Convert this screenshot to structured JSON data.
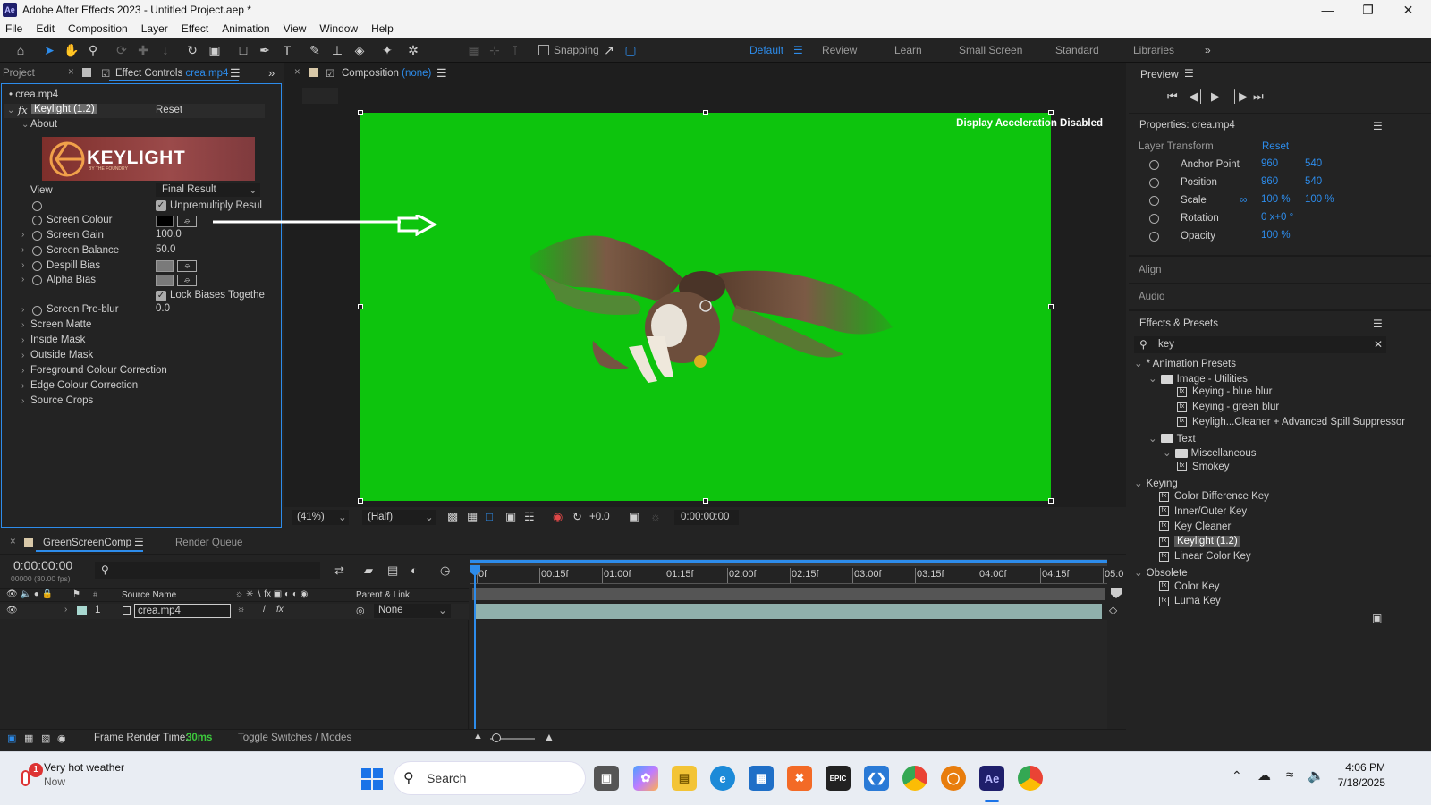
{
  "window": {
    "title": "Adobe After Effects 2023 - Untitled Project.aep *",
    "app_icon": "Ae"
  },
  "menu": [
    "File",
    "Edit",
    "Composition",
    "Layer",
    "Effect",
    "Animation",
    "View",
    "Window",
    "Help"
  ],
  "toolbar": {
    "snapping_label": "Snapping",
    "workspaces": [
      "Default",
      "Review",
      "Learn",
      "Small Screen",
      "Standard",
      "Libraries"
    ],
    "active_workspace": "Default"
  },
  "left_panel": {
    "tab_project": "Project",
    "tab_effect_controls": "Effect Controls",
    "tab_file": "crea.mp4",
    "layer_name": "• crea.mp4",
    "effect_name": "Keylight (1.2)",
    "reset": "Reset",
    "about": "About",
    "logo_text": "KEYLIGHT",
    "logo_sub": "BY THE FOUNDRY",
    "view_label": "View",
    "view_value": "Final Result",
    "unpremultiply": "Unpremultiply Resul",
    "screen_colour": "Screen Colour",
    "screen_gain": "Screen Gain",
    "screen_gain_val": "100.0",
    "screen_balance": "Screen Balance",
    "screen_balance_val": "50.0",
    "despill_bias": "Despill Bias",
    "alpha_bias": "Alpha Bias",
    "lock_biases": "Lock Biases Togethe",
    "screen_preblur": "Screen Pre-blur",
    "screen_preblur_val": "0.0",
    "groups": [
      "Screen Matte",
      "Inside Mask",
      "Outside Mask",
      "Foreground Colour Correction",
      "Edge Colour Correction",
      "Source Crops"
    ]
  },
  "composition": {
    "tab_label": "Composition",
    "tab_value": "(none)",
    "accel_msg": "Display Acceleration Disabled",
    "background_color": "#0dc40d",
    "zoom": "(41%)",
    "resolution": "(Half)",
    "exposure": "+0.0",
    "timecode": "0:00:00:00"
  },
  "right_panel": {
    "preview": "Preview",
    "properties_title": "Properties: crea.mp4",
    "layer_transform": "Layer Transform",
    "reset": "Reset",
    "props": [
      {
        "name": "Anchor Point",
        "v1": "960",
        "v2": "540"
      },
      {
        "name": "Position",
        "v1": "960",
        "v2": "540"
      },
      {
        "name": "Scale",
        "v1": "100 %",
        "v2": "100 %"
      },
      {
        "name": "Rotation",
        "v1": "0 x+0 °",
        "v2": ""
      },
      {
        "name": "Opacity",
        "v1": "100 %",
        "v2": ""
      }
    ],
    "align": "Align",
    "audio": "Audio",
    "effects_presets": "Effects & Presets",
    "search_value": "key",
    "tree": [
      {
        "label": "* Animation Presets",
        "indent": 0,
        "type": "caret"
      },
      {
        "label": "Image - Utilities",
        "indent": 1,
        "type": "folder"
      },
      {
        "label": "Keying - blue blur",
        "indent": 3,
        "type": "preset"
      },
      {
        "label": "Keying - green blur",
        "indent": 3,
        "type": "preset"
      },
      {
        "label": "Keyligh...Cleaner + Advanced Spill Suppressor",
        "indent": 3,
        "type": "preset"
      },
      {
        "label": "Text",
        "indent": 1,
        "type": "folder"
      },
      {
        "label": "Miscellaneous",
        "indent": 2,
        "type": "folder"
      },
      {
        "label": "Smokey",
        "indent": 3,
        "type": "preset"
      },
      {
        "label": "Keying",
        "indent": 0,
        "type": "caret"
      },
      {
        "label": "Color Difference Key",
        "indent": 1,
        "type": "fx"
      },
      {
        "label": "Inner/Outer Key",
        "indent": 1,
        "type": "fx"
      },
      {
        "label": "Key Cleaner",
        "indent": 1,
        "type": "fx"
      },
      {
        "label": "Keylight (1.2)",
        "indent": 1,
        "type": "fx-selected"
      },
      {
        "label": "Linear Color Key",
        "indent": 1,
        "type": "fx"
      },
      {
        "label": "Obsolete",
        "indent": 0,
        "type": "caret"
      },
      {
        "label": "Color Key",
        "indent": 1,
        "type": "fx"
      },
      {
        "label": "Luma Key",
        "indent": 1,
        "type": "fx"
      }
    ]
  },
  "timeline": {
    "comp_tab": "GreenScreenComp",
    "render_queue": "Render Queue",
    "timecode": "0:00:00:00",
    "fps": "00000 (30.00 fps)",
    "col_source": "Source Name",
    "col_parent": "Parent & Link",
    "layer_num": "1",
    "layer_name": "crea.mp4",
    "parent_value": "None",
    "ruler": [
      "0f",
      "00:15f",
      "01:00f",
      "01:15f",
      "02:00f",
      "02:15f",
      "03:00f",
      "03:15f",
      "04:00f",
      "04:15f",
      "05:0"
    ],
    "frame_render_label": "Frame Render Time:",
    "frame_render_value": "30ms",
    "toggle": "Toggle Switches / Modes"
  },
  "taskbar": {
    "weather_title": "Very hot weather",
    "weather_sub": "Now",
    "search": "Search",
    "time": "4:06 PM",
    "date": "7/18/2025",
    "badge": "1"
  }
}
